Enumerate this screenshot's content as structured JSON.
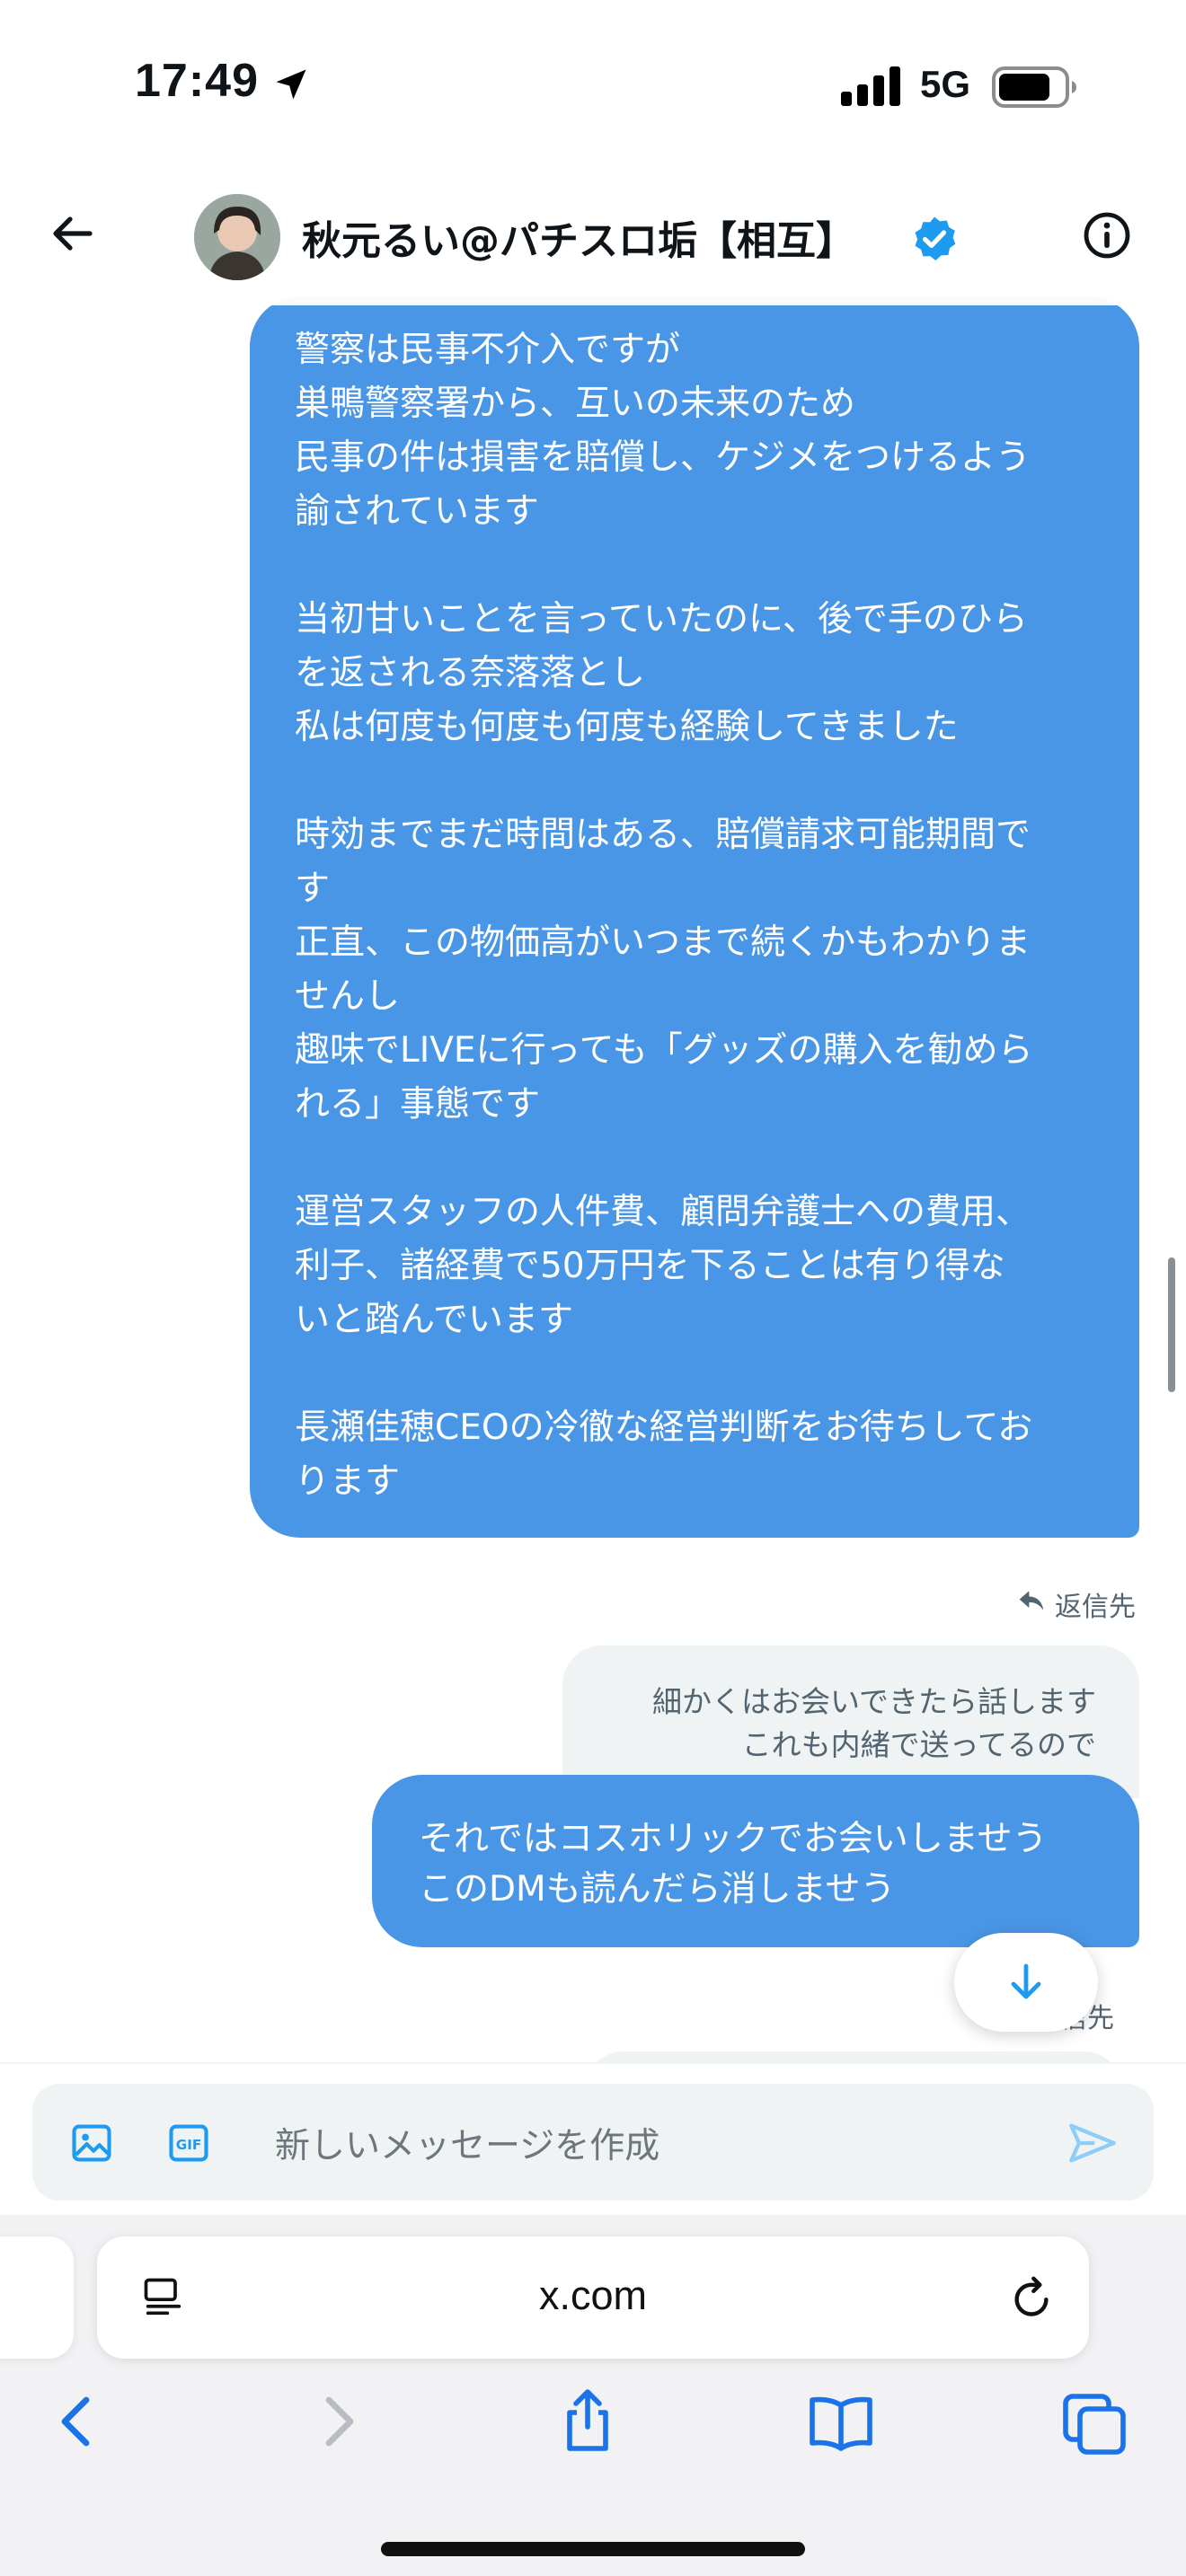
{
  "status_bar": {
    "time": "17:49",
    "network": "5G"
  },
  "header": {
    "name": "秋元るい@パチスロ垢【相互】"
  },
  "messages": {
    "big_bubble_lines": [
      "警察は民事不介入ですが",
      "巣鴨警察署から、互いの未来のため",
      "民事の件は損害を賠償し、ケジメをつけるよう",
      "諭されています",
      "当初甘いことを言っていたのに、後で手のひら",
      "を返される奈落落とし",
      "私は何度も何度も何度も経験してきました",
      "時効までまだ時間はある、賠償請求可能期間で",
      "す",
      "正直、この物価高がいつまで続くかもわかりま",
      "せんし",
      "趣味でLIVEに行っても「グッズの購入を勧めら",
      "れる」事態です",
      "運営スタッフの人件費、顧問弁護士への費用、",
      "利子、諸経費で50万円を下ることは有り得な",
      "いと踏んでいます",
      "長瀬佳穂CEOの冷徹な経営判断をお待ちしてお",
      "ります"
    ],
    "reply_label": "返信先",
    "quoted_lines": [
      "細かくはお会いできたら話します",
      "これも内緒で送ってるので"
    ],
    "reply_lines": [
      "それではコスホリックでお会いしませう",
      "このDMも読んだら消しませう"
    ],
    "reply_label_2": "信先"
  },
  "composer": {
    "placeholder": "新しいメッセージを作成"
  },
  "browser": {
    "url": "x.com"
  },
  "colors": {
    "bubble": "#4a96e6",
    "accent": "#1d9bf0",
    "safari_blue": "#1a73e8"
  },
  "icons": [
    "back-arrow-icon",
    "verified-badge-icon",
    "info-icon",
    "reply-icon",
    "arrow-down-icon",
    "image-icon",
    "gif-icon",
    "send-icon",
    "reader-icon",
    "reload-icon",
    "chevron-left-icon",
    "chevron-right-icon",
    "share-icon",
    "bookmarks-icon",
    "tabs-icon"
  ]
}
